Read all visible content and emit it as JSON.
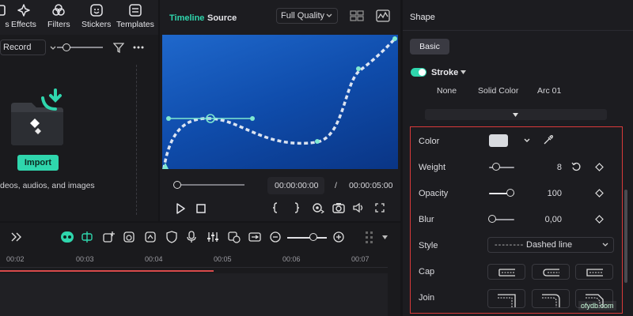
{
  "toolbar": {
    "items": [
      {
        "label": "s",
        "icon": "partial-icon"
      },
      {
        "label": "Effects",
        "icon": "sparkle-icon"
      },
      {
        "label": "Filters",
        "icon": "filters-icon"
      },
      {
        "label": "Stickers",
        "icon": "sticker-icon"
      },
      {
        "label": "Templates",
        "icon": "templates-icon"
      }
    ]
  },
  "media": {
    "record_label": "Record",
    "import_label": "Import",
    "hint": "deos, audios, and images"
  },
  "preview": {
    "tabs": {
      "timeline": "Timeline",
      "source": "Source"
    },
    "quality": "Full Quality",
    "current_time": "00:00:00:00",
    "separator": "/",
    "total_time": "00:00:05:00",
    "progress": 0
  },
  "shape": {
    "title": "Shape",
    "basic_label": "Basic",
    "stroke_label": "Stroke",
    "stroke_enabled": true,
    "style_chips": [
      "None",
      "Solid Color",
      "Arc 01"
    ],
    "color_label": "Color",
    "color_value": "#d8dadf",
    "weight_label": "Weight",
    "weight_value": "8",
    "opacity_label": "Opacity",
    "opacity_value": "100",
    "blur_label": "Blur",
    "blur_value": "0,00",
    "style_label": "Style",
    "style_value": "Dashed line",
    "style_dashes": "--------",
    "cap_label": "Cap",
    "join_label": "Join"
  },
  "timeline": {
    "ruler": [
      "00:02",
      "00:03",
      "00:04",
      "00:05",
      "00:06",
      "00:07"
    ]
  },
  "watermark": "ofydb.com",
  "colors": {
    "accent": "#2fd6ad",
    "highlight_border": "#d93a3a",
    "playhead": "#d94b4b"
  }
}
